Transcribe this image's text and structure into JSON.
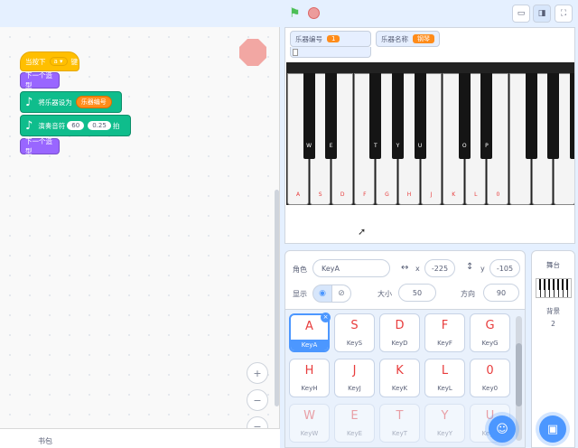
{
  "code": {
    "event_block": {
      "prefix": "当按下",
      "key": "a",
      "suffix": "键"
    },
    "next_costume_1": "下一个造型",
    "set_instrument": {
      "label": "将乐器设为",
      "value": "乐器编号"
    },
    "play_note": {
      "label": "演奏音符",
      "note": "60",
      "beats": "0.25",
      "unit": "拍"
    },
    "next_costume_2": "下一个造型",
    "backpack_label": "书包"
  },
  "stage": {
    "monitor_instrument_id": {
      "label": "乐器编号",
      "value": "1"
    },
    "monitor_instrument_name": {
      "label": "乐器名称",
      "value": "钢琴"
    },
    "black_key_labels": [
      "W",
      "E",
      "T",
      "Y",
      "U",
      "O",
      "P"
    ],
    "white_key_labels": [
      "A",
      "S",
      "D",
      "F",
      "G",
      "H",
      "J",
      "K",
      "L",
      "0"
    ]
  },
  "sprite_info": {
    "sprite_label": "角色",
    "sprite_name": "KeyA",
    "x_label": "x",
    "x_value": "-225",
    "y_label": "y",
    "y_value": "-105",
    "show_label": "显示",
    "size_label": "大小",
    "size_value": "50",
    "direction_label": "方向",
    "direction_value": "90"
  },
  "sprites": [
    {
      "letter": "A",
      "name": "KeyA"
    },
    {
      "letter": "S",
      "name": "KeyS"
    },
    {
      "letter": "D",
      "name": "KeyD"
    },
    {
      "letter": "F",
      "name": "KeyF"
    },
    {
      "letter": "G",
      "name": "KeyG"
    },
    {
      "letter": "H",
      "name": "KeyH"
    },
    {
      "letter": "J",
      "name": "KeyJ"
    },
    {
      "letter": "K",
      "name": "KeyK"
    },
    {
      "letter": "L",
      "name": "KeyL"
    },
    {
      "letter": "0",
      "name": "Key0"
    },
    {
      "letter": "W",
      "name": "KeyW"
    },
    {
      "letter": "E",
      "name": "KeyE"
    },
    {
      "letter": "T",
      "name": "KeyT"
    },
    {
      "letter": "Y",
      "name": "KeyY"
    },
    {
      "letter": "U",
      "name": "KeyU"
    }
  ],
  "stage_pane": {
    "title": "舞台",
    "backdrop_label": "背景",
    "backdrop_count": "2"
  },
  "colors": {
    "accent": "#4c97ff",
    "music": "#0fbd8c",
    "event": "#ffbf00",
    "looks": "#9966ff",
    "data": "#ff8c1a",
    "key_label": "#e83c3c"
  }
}
